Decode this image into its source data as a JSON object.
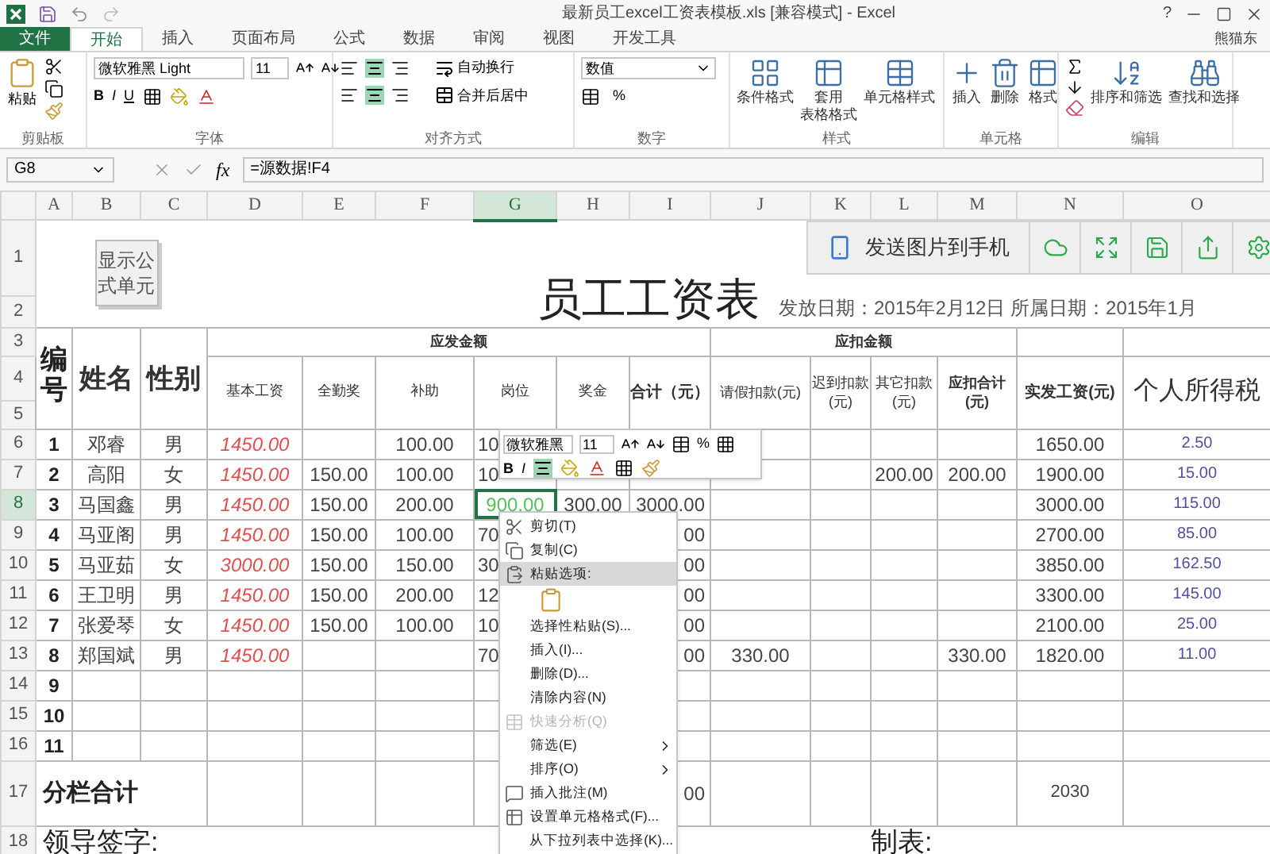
{
  "window": {
    "title": "最新员工excel工资表模板.xls  [兼容模式] - Excel",
    "help": "?",
    "user": "熊猫东"
  },
  "tabs": [
    {
      "label": "文件",
      "kind": "file",
      "selected": false
    },
    {
      "label": "开始",
      "kind": "tab",
      "selected": true
    },
    {
      "label": "插入",
      "kind": "tab",
      "selected": false
    },
    {
      "label": "页面布局",
      "kind": "tab",
      "selected": false
    },
    {
      "label": "公式",
      "kind": "tab",
      "selected": false
    },
    {
      "label": "数据",
      "kind": "tab",
      "selected": false
    },
    {
      "label": "审阅",
      "kind": "tab",
      "selected": false
    },
    {
      "label": "视图",
      "kind": "tab",
      "selected": false
    },
    {
      "label": "开发工具",
      "kind": "tab",
      "selected": false
    }
  ],
  "ribbon": {
    "clipboard": {
      "label": "剪贴板",
      "paste": "粘贴"
    },
    "font": {
      "label": "字体",
      "name": "微软雅黑 Light",
      "size": "11",
      "bold": "B",
      "italic": "I",
      "underline": "U"
    },
    "alignment": {
      "label": "对齐方式",
      "wrap": "自动换行",
      "merge": "合并后居中"
    },
    "number": {
      "label": "数字",
      "format": "数值",
      "percent": "%"
    },
    "styles": {
      "label": "样式",
      "buttons": [
        {
          "lines": [
            "条件格式"
          ]
        },
        {
          "lines": [
            "套用",
            "表格格式"
          ]
        },
        {
          "lines": [
            "单元格样式"
          ]
        }
      ]
    },
    "cells": {
      "label": "单元格",
      "buttons": [
        "插入",
        "删除",
        "格式"
      ]
    },
    "editing": {
      "label": "编辑",
      "buttons": [
        "排序和筛选",
        "查找和选择"
      ]
    }
  },
  "formula_bar": {
    "name_box": "G8",
    "fx": "fx",
    "formula": "=源数据!F4"
  },
  "sheet": {
    "columns": [
      {
        "label": "A",
        "selected": false
      },
      {
        "label": "B",
        "selected": false
      },
      {
        "label": "C",
        "selected": false
      },
      {
        "label": "D",
        "selected": false
      },
      {
        "label": "E",
        "selected": false
      },
      {
        "label": "F",
        "selected": false
      },
      {
        "label": "G",
        "selected": true
      },
      {
        "label": "H",
        "selected": false
      },
      {
        "label": "I",
        "selected": false
      },
      {
        "label": "J",
        "selected": false
      },
      {
        "label": "K",
        "selected": false
      },
      {
        "label": "L",
        "selected": false
      },
      {
        "label": "M",
        "selected": false
      },
      {
        "label": "N",
        "selected": false
      },
      {
        "label": "O",
        "selected": false
      }
    ],
    "row_numbers": [
      "1",
      "2",
      "3",
      "4",
      "5",
      "6",
      "7",
      "8",
      "9",
      "10",
      "11",
      "12",
      "13",
      "14",
      "15",
      "16",
      "17",
      "18"
    ],
    "formula_button": "显示公式单元",
    "title": "员工工资表",
    "dates": "发放日期：2015年2月12日 所属日期：2015年1月",
    "headers": {
      "id": "编号",
      "name": "姓名",
      "gender": "性别",
      "gross_group": "应发金额",
      "deduct_group": "应扣金额",
      "gross": [
        "基本工资",
        "全勤奖",
        "补助",
        "岗位",
        "奖金",
        "合计（元）"
      ],
      "deduct": [
        "请假扣款(元)",
        "迟到扣款(元)",
        "其它扣款(元)",
        "应扣合计(元)"
      ],
      "net": "实发工资(元)",
      "tax": "个人所得税"
    },
    "records": [
      {
        "selected": false,
        "cells": [
          "1",
          "邓睿",
          "男",
          "1450.00",
          "",
          "100.00",
          "10",
          "",
          "",
          "",
          "",
          "",
          "",
          "1650.00",
          "2.50"
        ]
      },
      {
        "selected": false,
        "cells": [
          "2",
          "高阳",
          "女",
          "1450.00",
          "150.00",
          "100.00",
          "10",
          "",
          "",
          "",
          "",
          "200.00",
          "200.00",
          "1900.00",
          "15.00"
        ]
      },
      {
        "selected": true,
        "cells": [
          "3",
          "马国鑫",
          "男",
          "1450.00",
          "150.00",
          "200.00",
          "900.00",
          "300.00",
          "3000.00",
          "",
          "",
          "",
          "",
          "3000.00",
          "115.00"
        ]
      },
      {
        "selected": false,
        "cells": [
          "4",
          "马亚阁",
          "男",
          "1450.00",
          "150.00",
          "100.00",
          "70",
          "",
          "00",
          "",
          "",
          "",
          "",
          "2700.00",
          "85.00"
        ]
      },
      {
        "selected": false,
        "cells": [
          "5",
          "马亚茹",
          "女",
          "3000.00",
          "150.00",
          "150.00",
          "30",
          "",
          "00",
          "",
          "",
          "",
          "",
          "3850.00",
          "162.50"
        ]
      },
      {
        "selected": false,
        "cells": [
          "6",
          "王卫明",
          "男",
          "1450.00",
          "150.00",
          "200.00",
          "12",
          "",
          "00",
          "",
          "",
          "",
          "",
          "3300.00",
          "145.00"
        ]
      },
      {
        "selected": false,
        "cells": [
          "7",
          "张爱琴",
          "女",
          "1450.00",
          "150.00",
          "100.00",
          "10",
          "",
          "00",
          "",
          "",
          "",
          "",
          "2100.00",
          "25.00"
        ]
      },
      {
        "selected": false,
        "cells": [
          "8",
          "郑国斌",
          "男",
          "1450.00",
          "",
          "",
          "70",
          "",
          "00",
          "330.00",
          "",
          "",
          "330.00",
          "1820.00",
          "11.00"
        ]
      },
      {
        "selected": false,
        "cells": [
          "9",
          "",
          "",
          "",
          "",
          "",
          "",
          "",
          "",
          "",
          "",
          "",
          "",
          "",
          ""
        ]
      },
      {
        "selected": false,
        "cells": [
          "10",
          "",
          "",
          "",
          "",
          "",
          "",
          "",
          "",
          "",
          "",
          "",
          "",
          "",
          ""
        ]
      },
      {
        "selected": false,
        "cells": [
          "11",
          "",
          "",
          "",
          "",
          "",
          "",
          "",
          "",
          "",
          "",
          "",
          "",
          "",
          ""
        ]
      }
    ],
    "total": {
      "label": "分栏合计",
      "gross_total": "00",
      "net": "2030"
    },
    "signature": "领导签字:",
    "preparer": "制表:"
  },
  "share_bar": {
    "send": "发送图片到手机"
  },
  "mini_toolbar": {
    "font": "微软雅黑",
    "size": "11",
    "bold": "B",
    "italic": "I",
    "percent": "%"
  },
  "context_menu": [
    {
      "label": "剪切(T)",
      "kind": "item",
      "disabled": false,
      "highlighted": false,
      "submenu": false
    },
    {
      "label": "复制(C)",
      "kind": "item",
      "disabled": false,
      "highlighted": false,
      "submenu": false
    },
    {
      "label": "粘贴选项:",
      "kind": "item",
      "disabled": false,
      "highlighted": true,
      "submenu": false
    },
    {
      "kind": "paste"
    },
    {
      "label": "选择性粘贴(S)...",
      "kind": "item",
      "disabled": false,
      "highlighted": false,
      "submenu": false
    },
    {
      "label": "插入(I)...",
      "kind": "item",
      "disabled": false,
      "highlighted": false,
      "submenu": false
    },
    {
      "label": "删除(D)...",
      "kind": "item",
      "disabled": false,
      "highlighted": false,
      "submenu": false
    },
    {
      "label": "清除内容(N)",
      "kind": "item",
      "disabled": false,
      "highlighted": false,
      "submenu": false
    },
    {
      "label": "快速分析(Q)",
      "kind": "item",
      "disabled": true,
      "highlighted": false,
      "submenu": false
    },
    {
      "label": "筛选(E)",
      "kind": "item",
      "disabled": false,
      "highlighted": false,
      "submenu": true
    },
    {
      "label": "排序(O)",
      "kind": "item",
      "disabled": false,
      "highlighted": false,
      "submenu": true
    },
    {
      "label": "插入批注(M)",
      "kind": "item",
      "disabled": false,
      "highlighted": false,
      "submenu": false
    },
    {
      "label": "设置单元格格式(F)...",
      "kind": "item",
      "disabled": false,
      "highlighted": false,
      "submenu": false
    },
    {
      "label": "从下拉列表中选择(K)...",
      "kind": "item",
      "disabled": false,
      "highlighted": false,
      "submenu": false
    }
  ]
}
